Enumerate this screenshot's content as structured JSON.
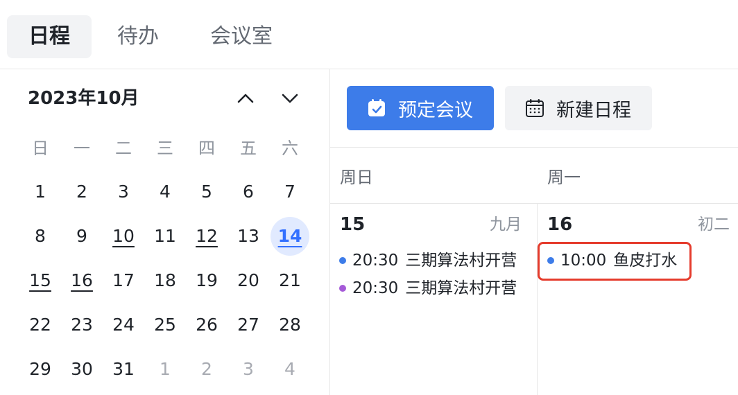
{
  "tabs": [
    {
      "label": "日程",
      "active": true
    },
    {
      "label": "待办",
      "active": false
    },
    {
      "label": "会议室",
      "active": false
    }
  ],
  "mini_calendar": {
    "title": "2023年10月",
    "weekdays": [
      "日",
      "一",
      "二",
      "三",
      "四",
      "五",
      "六"
    ],
    "weeks": [
      [
        {
          "d": "1"
        },
        {
          "d": "2"
        },
        {
          "d": "3"
        },
        {
          "d": "4"
        },
        {
          "d": "5"
        },
        {
          "d": "6"
        },
        {
          "d": "7"
        }
      ],
      [
        {
          "d": "8"
        },
        {
          "d": "9"
        },
        {
          "d": "10",
          "event": true
        },
        {
          "d": "11"
        },
        {
          "d": "12",
          "event": true
        },
        {
          "d": "13"
        },
        {
          "d": "14",
          "today": true,
          "event": true
        }
      ],
      [
        {
          "d": "15",
          "event": true
        },
        {
          "d": "16",
          "event": true
        },
        {
          "d": "17"
        },
        {
          "d": "18"
        },
        {
          "d": "19"
        },
        {
          "d": "20"
        },
        {
          "d": "21"
        }
      ],
      [
        {
          "d": "22"
        },
        {
          "d": "23"
        },
        {
          "d": "24"
        },
        {
          "d": "25"
        },
        {
          "d": "26"
        },
        {
          "d": "27"
        },
        {
          "d": "28"
        }
      ],
      [
        {
          "d": "29"
        },
        {
          "d": "30"
        },
        {
          "d": "31"
        },
        {
          "d": "1",
          "muted": true
        },
        {
          "d": "2",
          "muted": true
        },
        {
          "d": "3",
          "muted": true
        },
        {
          "d": "4",
          "muted": true
        }
      ]
    ],
    "today_bg": "#e1eaff",
    "today_color": "#3370ff"
  },
  "toolbar": {
    "book_meeting_label": "预定会议",
    "new_event_label": "新建日程",
    "accent": "#3d7ce9"
  },
  "columns": [
    {
      "weekday": "周日",
      "date": "15",
      "lunar": "九月",
      "events": [
        {
          "time": "20:30",
          "title": "三期算法村开营",
          "color": "#3d7ce9"
        },
        {
          "time": "20:30",
          "title": "三期算法村开营",
          "color": "#a55ad8"
        }
      ]
    },
    {
      "weekday": "周一",
      "date": "16",
      "lunar": "初二",
      "events": [
        {
          "time": "10:00",
          "title": "鱼皮打水",
          "color": "#3d7ce9"
        }
      ]
    }
  ],
  "annotation_color": "#e53b2c"
}
